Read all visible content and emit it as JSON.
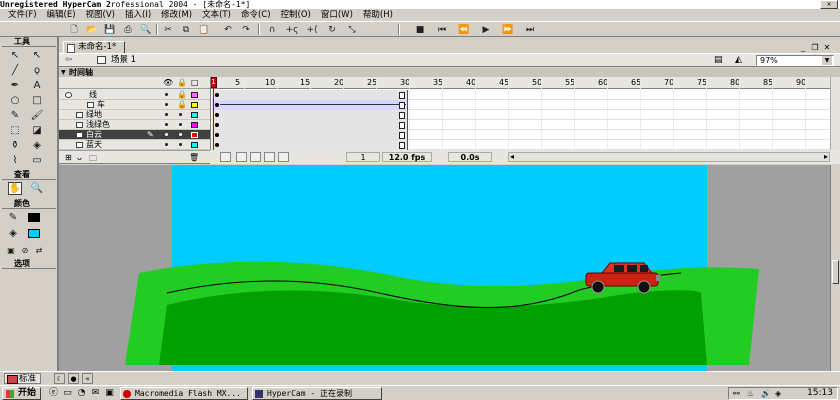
{
  "window": {
    "title": "Unregistered HyperCam 2 rofessional 2004 - [未命名-1*]",
    "watermark": "Unregistered HyperCam 2",
    "title_rest": "rofessional 2004 - [未命名-1*]",
    "close_glyph": "✕"
  },
  "menu": [
    "文件(F)",
    "编辑(E)",
    "视图(V)",
    "插入(I)",
    "修改(M)",
    "文本(T)",
    "命令(C)",
    "控制(O)",
    "窗口(W)",
    "帮助(H)"
  ],
  "tools_panel": {
    "title": "工具",
    "view_title": "查看",
    "colors_title": "颜色",
    "options_title": "选项",
    "stroke_color": "#000000",
    "fill_color": "#00ccff"
  },
  "document": {
    "tab_label": "未命名-1*",
    "scene_label": "场景 1",
    "zoom": "97%",
    "back_glyph": "⇦"
  },
  "timeline": {
    "title": "时间轴",
    "frame_numbers": [
      "5",
      "10",
      "15",
      "20",
      "25",
      "30",
      "35",
      "40",
      "45",
      "50",
      "55",
      "60",
      "65",
      "70",
      "75",
      "80",
      "85",
      "90"
    ],
    "current_frame_marker": "1",
    "layers": [
      {
        "name": "线",
        "type": "guide",
        "color": "#ff66ff"
      },
      {
        "name": "车",
        "type": "guided",
        "color": "#ffff00"
      },
      {
        "name": "绿地",
        "type": "normal",
        "color": "#00ffff"
      },
      {
        "name": "浅绿色",
        "type": "normal",
        "color": "#ff00ff"
      },
      {
        "name": "白云",
        "type": "normal",
        "color": "#ff0000",
        "selected": true
      },
      {
        "name": "蓝天",
        "type": "normal",
        "color": "#00ffff"
      }
    ],
    "status": {
      "current_frame": "1",
      "frame_rate": "12.0 fps",
      "elapsed": "0.0s"
    }
  },
  "stage": {
    "sky_color": "#00ccff",
    "grass_light": "#22cc22",
    "grass_dark": "#00a000",
    "car_color": "#cc2211",
    "pasteboard_color": "#a0a0a0"
  },
  "bottom_strip": {
    "tab_label": "标准"
  },
  "taskbar": {
    "start_label": "开始",
    "tasks": [
      "Macromedia Flash MX...",
      "HyperCam - 正在录制"
    ],
    "clock": "15:13"
  }
}
